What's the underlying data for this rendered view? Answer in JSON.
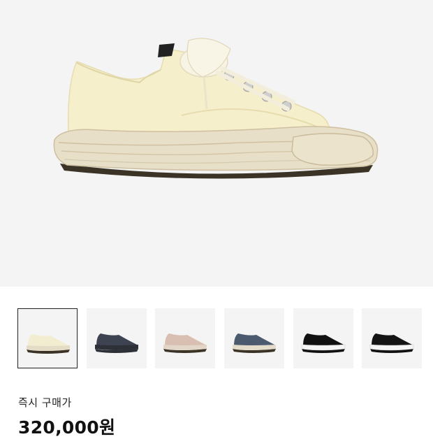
{
  "product": {
    "image_name": "product-main-image",
    "color_main": "#f5efcc",
    "sole_color": "#e8dfc9",
    "outsole_color": "#3a3326"
  },
  "thumbnails": [
    {
      "name": "thumb-cream",
      "upper": "#f2ecd0",
      "sole": "#e4dcc6",
      "selected": true
    },
    {
      "name": "thumb-navy",
      "upper": "#3d4350",
      "sole": "#2e3038",
      "selected": false
    },
    {
      "name": "thumb-pink",
      "upper": "#d9bfb1",
      "sole": "#e1d6c7",
      "selected": false
    },
    {
      "name": "thumb-blue",
      "upper": "#4c5a6f",
      "sole": "#e3dccb",
      "selected": false
    },
    {
      "name": "thumb-black-white",
      "upper": "#111111",
      "sole": "#f5f5f5",
      "selected": false
    },
    {
      "name": "thumb-black",
      "upper": "#141414",
      "sole": "#f5f5f5",
      "selected": false
    }
  ],
  "purchase": {
    "label": "즉시 구매가",
    "price": "320,000원"
  }
}
